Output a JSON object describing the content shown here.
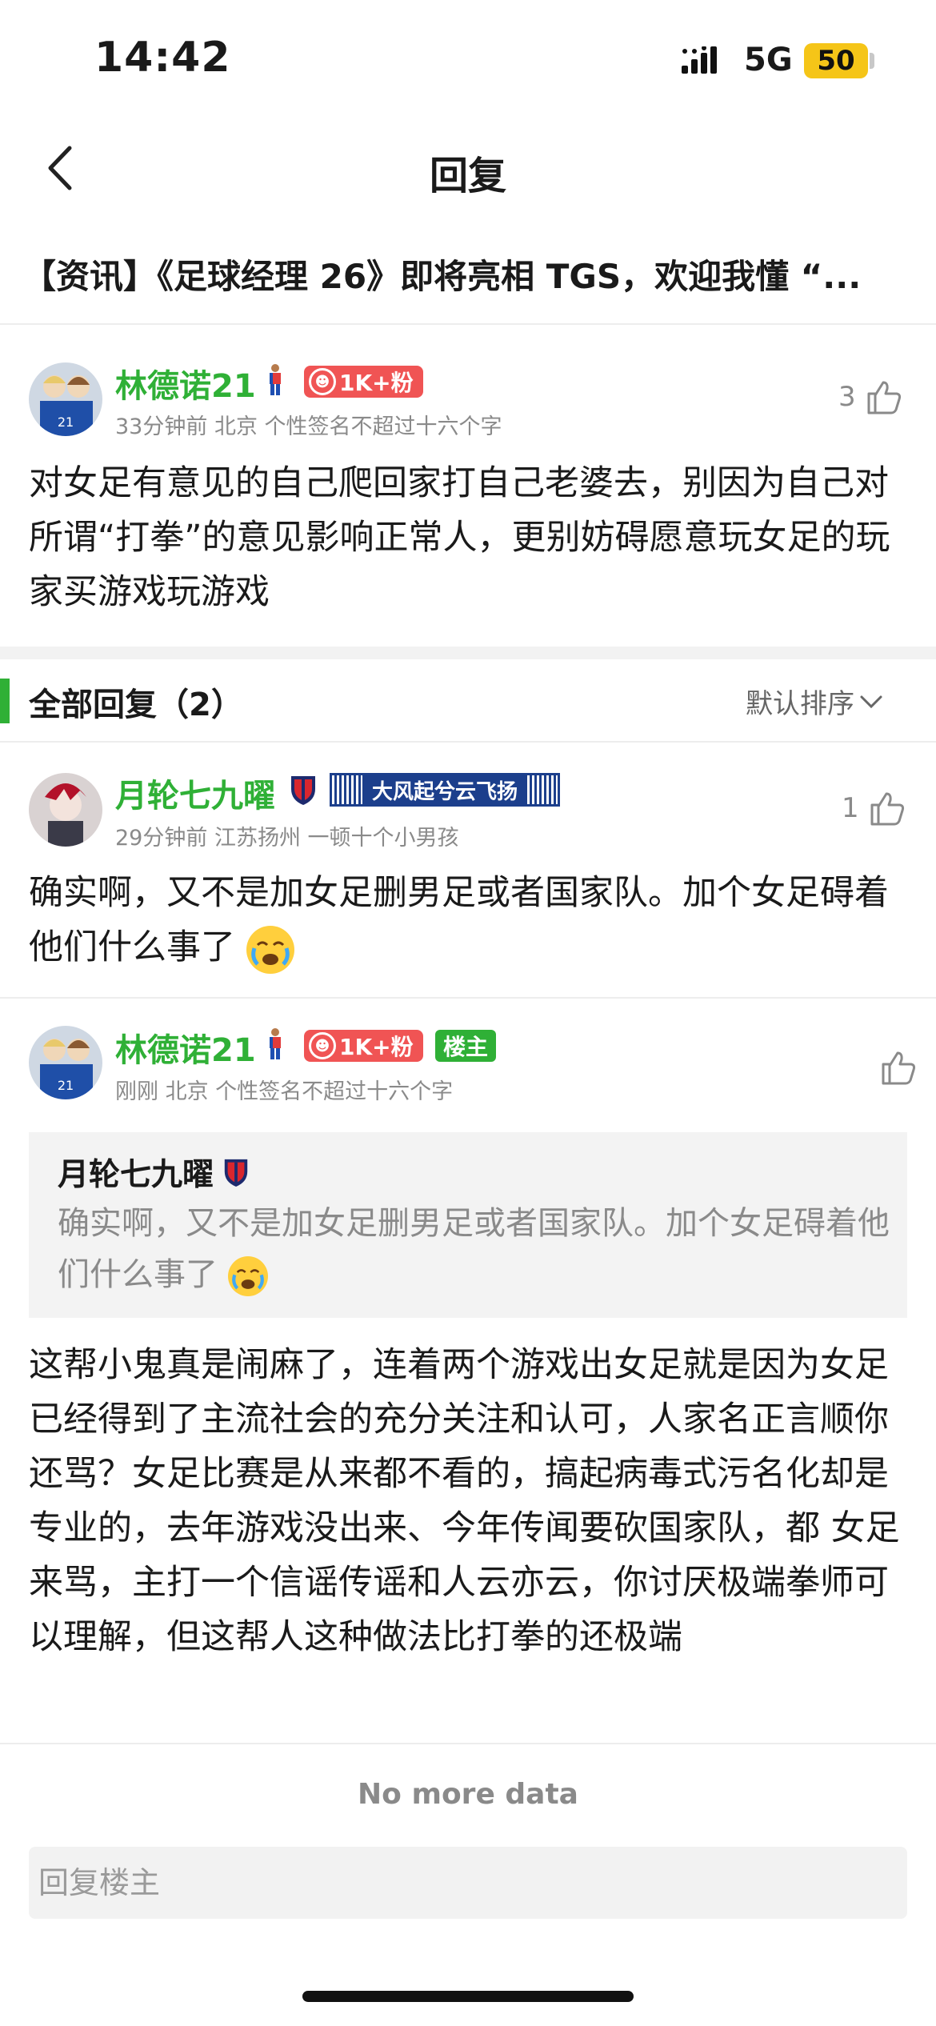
{
  "status_bar": {
    "time": "14:42",
    "network": "5G",
    "battery": "50"
  },
  "nav": {
    "title": "回复"
  },
  "post": {
    "title": "【资讯】《足球经理 26》即将亮相 TGS，欢迎我懂 “..."
  },
  "main_comment": {
    "username": "林德诺21",
    "fans_badge": "1K+粉",
    "meta": "33分钟前 北京 个性签名不超过十六个字",
    "likes": "3",
    "text": "对女足有意见的自己爬回家打自己老婆去，别因为自己对所谓“打拳”的意见影响正常人，更别妨碍愿意玩女足的玩家买游戏玩游戏"
  },
  "replies_header": {
    "label": "全部回复（2）",
    "sort_label": "默认排序"
  },
  "replies": [
    {
      "username": "月轮七九曜",
      "scarf_text": "大风起兮云飞扬",
      "meta": "29分钟前 江苏扬州 一顿十个小男孩",
      "likes": "1",
      "text": "确实啊，又不是加女足删男足或者国家队。加个女足碍着他们什么事了"
    },
    {
      "username": "林德诺21",
      "fans_badge": "1K+粉",
      "owner_badge": "楼主",
      "meta": "刚刚 北京 个性签名不超过十六个字",
      "likes": "",
      "quote_user": "月轮七九曜",
      "quote_text": "确实啊，又不是加女足删男足或者国家队。加个女足碍着他们什么事了",
      "text": "这帮小鬼真是闹麻了，连着两个游戏出女足就是因为女足已经得到了主流社会的充分关注和认可，人家名正言顺你还骂？女足比赛是从来都不看的，搞起病毒式污名化却是专业的，去年游戏没出来、今年传闻要砍国家队，都  女足来骂，主打一个信谣传谣和人云亦云，你讨厌极端拳师可以理解，但这帮人这种做法比打拳的还极端"
    }
  ],
  "footer": {
    "no_more": "No more data",
    "reply_placeholder": "回复楼主"
  },
  "colors": {
    "accent_green": "#2fb036",
    "badge_red": "#f05454",
    "battery_yellow": "#f5c518"
  }
}
